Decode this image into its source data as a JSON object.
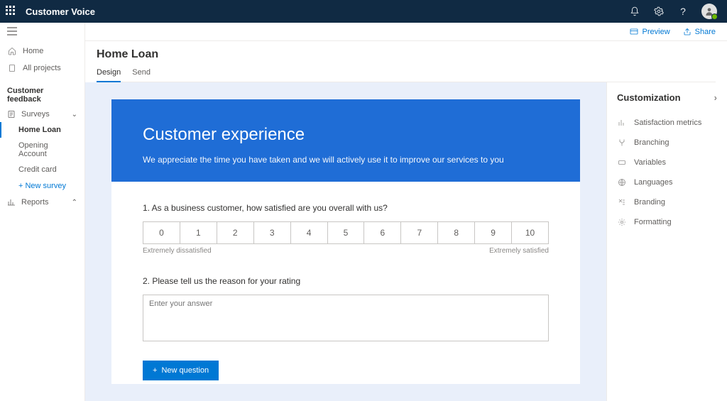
{
  "topbar": {
    "title": "Customer Voice"
  },
  "commands": {
    "preview": "Preview",
    "share": "Share"
  },
  "nav": {
    "home": "Home",
    "all_projects": "All projects",
    "section": "Customer feedback",
    "surveys": "Surveys",
    "children": [
      "Home Loan",
      "Opening Account",
      "Credit card"
    ],
    "add_new": "+ New survey",
    "reports": "Reports"
  },
  "page": {
    "title": "Home Loan",
    "tabs": [
      "Design",
      "Send"
    ]
  },
  "survey": {
    "hero_title": "Customer experience",
    "hero_sub": "We appreciate the time you have taken and we will actively use it to improve our services to you",
    "q1": "1. As a business customer, how satisfied are you overall with us?",
    "scale": [
      "0",
      "1",
      "2",
      "3",
      "4",
      "5",
      "6",
      "7",
      "8",
      "9",
      "10"
    ],
    "scale_low": "Extremely dissatisfied",
    "scale_high": "Extremely satisfied",
    "q2": "2. Please tell us the reason for your rating",
    "q2_placeholder": "Enter your answer",
    "new_question": "New question"
  },
  "customization": {
    "title": "Customization",
    "items": [
      "Satisfaction metrics",
      "Branching",
      "Variables",
      "Languages",
      "Branding",
      "Formatting"
    ]
  }
}
